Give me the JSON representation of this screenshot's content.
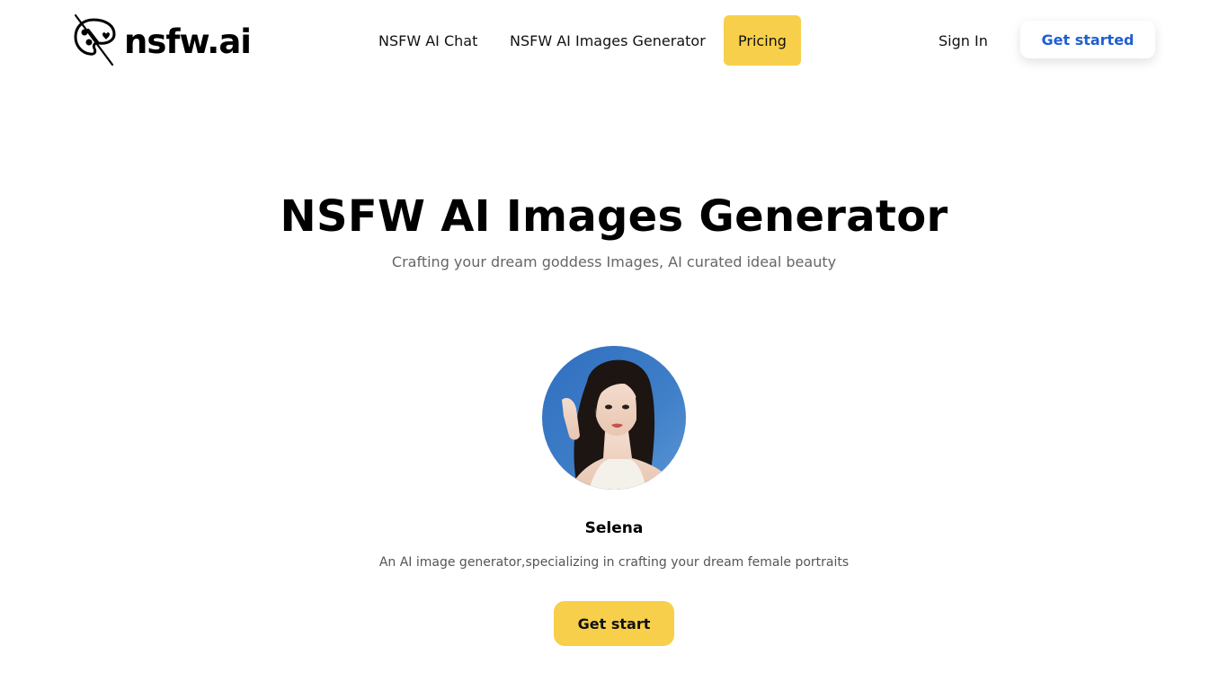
{
  "header": {
    "logo_text": "nsfw.ai",
    "logo_icon": "paint-palette-icon",
    "nav": [
      {
        "label": "NSFW AI Chat"
      },
      {
        "label": "NSFW AI Images Generator"
      },
      {
        "label": "Pricing",
        "active": true
      }
    ],
    "sign_in_label": "Sign In",
    "get_started_label": "Get started"
  },
  "hero": {
    "title": "NSFW AI Images Generator",
    "subtitle": "Crafting your dream goddess Images, AI curated ideal beauty"
  },
  "card": {
    "avatar": "woman-portrait-avatar",
    "name": "Selena",
    "description": "An AI image generator,specializing in crafting your dream female portraits",
    "cta_label": "Get start"
  },
  "colors": {
    "accent_yellow": "#f7cf4a",
    "link_blue": "#1f5fd1",
    "subtitle_gray": "#666666",
    "avatar_background": "#3f7fc8"
  }
}
